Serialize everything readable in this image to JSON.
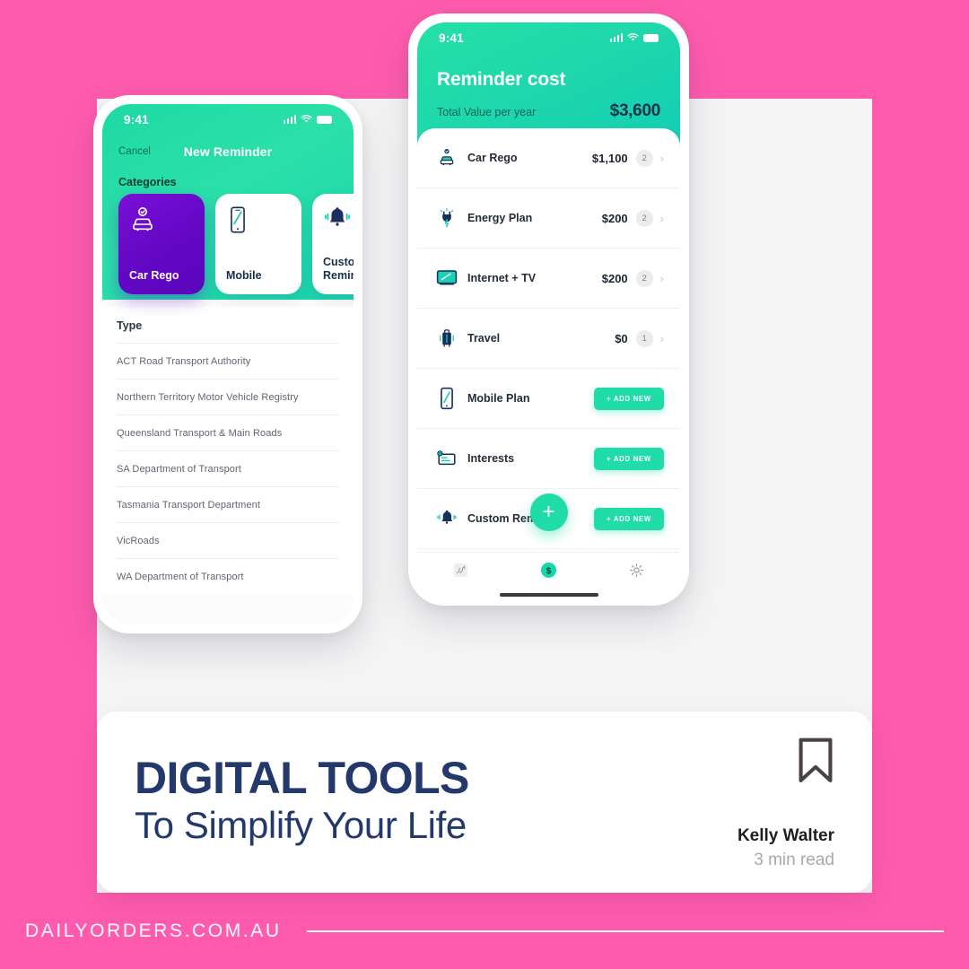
{
  "theme": {
    "background": "#FF5BAE",
    "panel": "#F5F5F6",
    "accent_teal": "#1FDCA9",
    "accent_purple": "#6207C4",
    "navy": "#23386B"
  },
  "left_phone": {
    "status": {
      "time": "9:41",
      "signal_icon": "cellular-bars-icon",
      "wifi_icon": "wifi-icon",
      "battery_icon": "battery-icon"
    },
    "nav": {
      "cancel_label": "Cancel",
      "title": "New Reminder"
    },
    "categories_label": "Categories",
    "categories": [
      {
        "name": "Car Rego",
        "icon": "car-check-icon",
        "active": true
      },
      {
        "name": "Mobile",
        "icon": "mobile-phone-icon",
        "active": false
      },
      {
        "name": "Custom Reminder",
        "icon": "bell-icon",
        "active": false
      }
    ],
    "list_header": "Type",
    "list_items": [
      "ACT Road Transport Authority",
      "Northern Territory Motor Vehicle Registry",
      "Queensland Transport & Main Roads",
      "SA Department of Transport",
      "Tasmania Transport Department",
      "VicRoads",
      "WA Department of Transport"
    ]
  },
  "right_phone": {
    "status": {
      "time": "9:41",
      "signal_icon": "cellular-bars-icon",
      "wifi_icon": "wifi-icon",
      "battery_icon": "battery-icon"
    },
    "title": "Reminder cost",
    "total_label": "Total Value per year",
    "total_value": "$3,600",
    "items": [
      {
        "name": "Car Rego",
        "icon": "car-check-icon",
        "amount": "$1,100",
        "count": "2",
        "action": "chevron"
      },
      {
        "name": "Energy Plan",
        "icon": "plug-icon",
        "amount": "$200",
        "count": "2",
        "action": "chevron"
      },
      {
        "name": "Internet + TV",
        "icon": "television-icon",
        "amount": "$200",
        "count": "2",
        "action": "chevron"
      },
      {
        "name": "Travel",
        "icon": "suitcase-icon",
        "amount": "$0",
        "count": "1",
        "action": "chevron"
      },
      {
        "name": "Mobile Plan",
        "icon": "mobile-phone-icon",
        "amount": "",
        "count": "",
        "action": "add",
        "add_label": "+ ADD NEW"
      },
      {
        "name": "Interests",
        "icon": "card-icon",
        "amount": "",
        "count": "",
        "action": "add",
        "add_label": "+ ADD NEW"
      },
      {
        "name": "Custom Reminder",
        "icon": "bell-icon",
        "amount": "",
        "count": "",
        "action": "add",
        "add_label": "+ ADD NEW"
      }
    ],
    "fab_label": "+",
    "tabs": [
      {
        "icon": "reminders-icon",
        "active": false
      },
      {
        "icon": "dollar-icon",
        "active": true
      },
      {
        "icon": "gear-icon",
        "active": false
      }
    ]
  },
  "bottom_card": {
    "title": "DIGITAL TOOLS",
    "subtitle": "To Simplify Your Life",
    "bookmark_icon": "bookmark-icon",
    "author": "Kelly Walter",
    "read_time": "3 min read"
  },
  "footer": {
    "site": "DAILYORDERS.COM.AU"
  }
}
